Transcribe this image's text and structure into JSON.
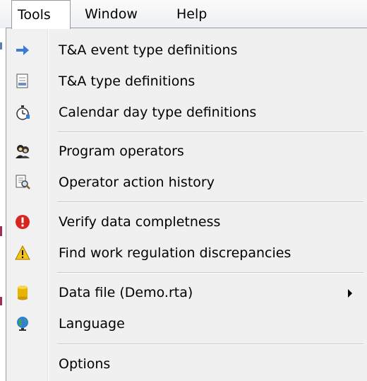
{
  "menubar": {
    "items": [
      {
        "label": "Tools"
      },
      {
        "label": "Window"
      },
      {
        "label": "Help"
      }
    ]
  },
  "menu": {
    "items": [
      {
        "label": "T&A event type definitions",
        "icon": "arrow-right-icon"
      },
      {
        "label": "T&A type definitions",
        "icon": "document-list-icon"
      },
      {
        "label": "Calendar day type definitions",
        "icon": "stopwatch-icon"
      },
      {
        "label": "Program operators",
        "icon": "users-icon"
      },
      {
        "label": "Operator action history",
        "icon": "document-search-icon"
      },
      {
        "label": "Verify data completness",
        "icon": "error-icon"
      },
      {
        "label": "Find work regulation discrepancies",
        "icon": "warning-icon"
      },
      {
        "label": "Data file (Demo.rta)",
        "icon": "database-icon",
        "has_submenu": true
      },
      {
        "label": "Language",
        "icon": "globe-icon"
      },
      {
        "label": "Options",
        "icon": ""
      }
    ]
  },
  "colors": {
    "menu_background": "#f0f0f0",
    "border": "#9a9a9a",
    "separator": "#c8c8c8",
    "arrow_icon": "#3a7bd5",
    "error_icon": "#d8261f",
    "warning_icon": "#f5c518",
    "database_icon": "#e8b400"
  }
}
